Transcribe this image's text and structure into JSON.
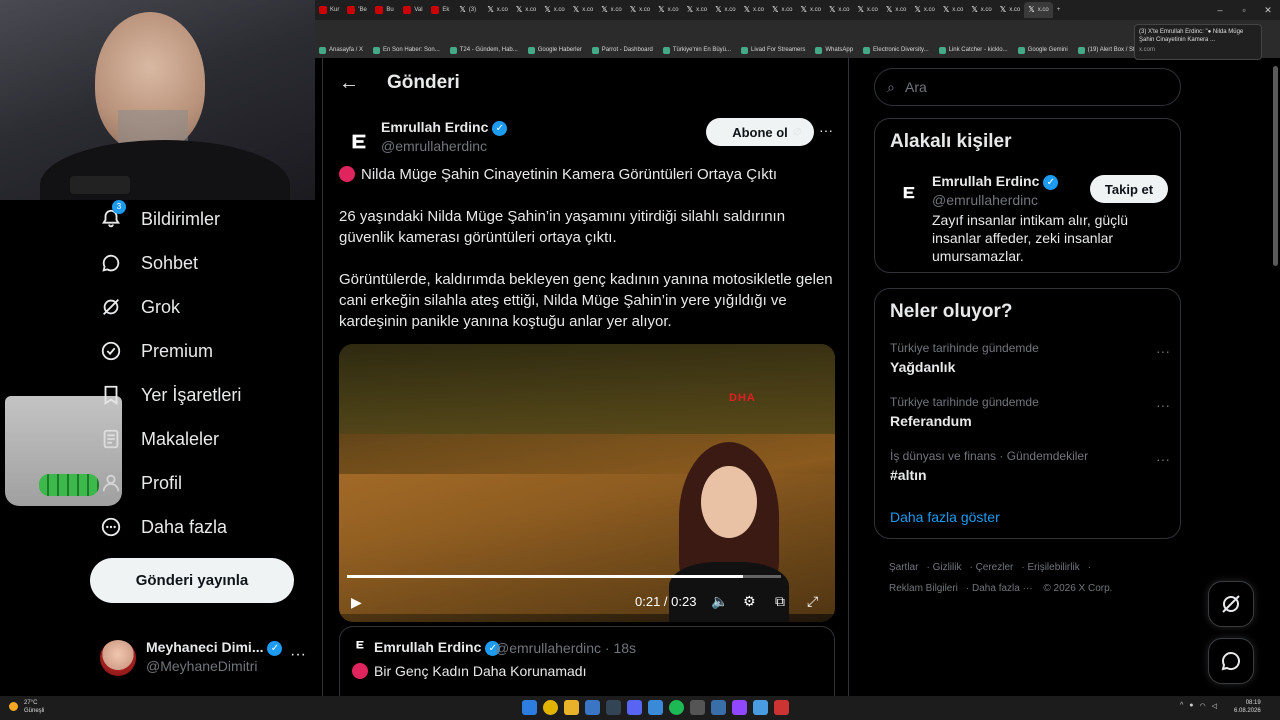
{
  "browser": {
    "tabs": [
      {
        "icon": "youtube-icon",
        "label": "Kur"
      },
      {
        "icon": "youtube-icon",
        "label": "'Be"
      },
      {
        "icon": "youtube-icon",
        "label": "Bu"
      },
      {
        "icon": "youtube-icon",
        "label": "Val"
      },
      {
        "icon": "youtube-icon",
        "label": "Ek"
      },
      {
        "icon": "x-icon",
        "label": "(3)"
      },
      {
        "icon": "x-icon",
        "label": "x.co"
      },
      {
        "icon": "x-icon",
        "label": "x.co"
      },
      {
        "icon": "x-icon",
        "label": "x.co"
      },
      {
        "icon": "x-icon",
        "label": "x.co"
      },
      {
        "icon": "x-icon",
        "label": "x.co"
      },
      {
        "icon": "x-icon",
        "label": "x.co"
      },
      {
        "icon": "x-icon",
        "label": "x.co"
      },
      {
        "icon": "x-icon",
        "label": "x.co"
      },
      {
        "icon": "x-icon",
        "label": "x.co"
      },
      {
        "icon": "x-icon",
        "label": "x.co"
      },
      {
        "icon": "x-icon",
        "label": "x.co"
      },
      {
        "icon": "x-icon",
        "label": "x.co"
      },
      {
        "icon": "x-icon",
        "label": "x.co"
      },
      {
        "icon": "x-icon",
        "label": "x.co"
      },
      {
        "icon": "x-icon",
        "label": "x.co"
      },
      {
        "icon": "x-icon",
        "label": "x.co"
      },
      {
        "icon": "x-icon",
        "label": "x.co"
      },
      {
        "icon": "x-icon",
        "label": "x.co"
      },
      {
        "icon": "x-icon",
        "label": "x.co"
      },
      {
        "icon": "x-icon",
        "label": "x.co"
      }
    ],
    "tab_tooltip": {
      "title": "(3) X'te Emrullah Erdinc: \"● Nilda Müge Şahin Cinayetinin Kamera ...",
      "url": "x.com"
    },
    "bookmarks": [
      "Anasayfa / X",
      "En Son Haber: Son...",
      "T24 - Gündem, Hab...",
      "Google Haberler",
      "Parrot - Dashboard",
      "Türkiye'nin En Büyü...",
      "Livad For Streamers",
      "WhatsApp",
      "Electronic Diversity...",
      "Link Catcher - kicklo...",
      "Google Gemini",
      "(19) Alert Box / Stre..."
    ]
  },
  "nav": {
    "notifications_badge": "3",
    "items": [
      {
        "label": "Bildirimler",
        "icon": "bell-icon"
      },
      {
        "label": "Sohbet",
        "icon": "chat-icon"
      },
      {
        "label": "Grok",
        "icon": "grok-icon"
      },
      {
        "label": "Premium",
        "icon": "verified-badge-icon"
      },
      {
        "label": "Yer İşaretleri",
        "icon": "bookmark-icon"
      },
      {
        "label": "Makaleler",
        "icon": "article-icon"
      },
      {
        "label": "Profil",
        "icon": "user-icon"
      },
      {
        "label": "Daha fazla",
        "icon": "more-circle-icon"
      }
    ],
    "post_button": "Gönderi yayınla",
    "account": {
      "name": "Meyhaneci Dimi...",
      "handle": "@MeyhaneDimitri"
    }
  },
  "main": {
    "title": "Gönderi",
    "author": {
      "name": "Emrullah Erdinc",
      "handle": "@emrullaherdinc",
      "logo": "E"
    },
    "subscribe_label": "Abone ol",
    "paragraphs": [
      "Nilda Müge Şahin Cinayetinin Kamera Görüntüleri Ortaya Çıktı",
      "26 yaşındaki Nilda Müge Şahin’in yaşamını yitirdiği silahlı saldırının güvenlik kamerası görüntüleri ortaya çıktı.",
      "Görüntülerde, kaldırımda bekleyen genç kadının yanına motosikletle gelen cani erkeğin silahla ateş ettiği, Nilda Müge Şahin’in yere yığıldığı ve kardeşinin panikle yanına koştuğu anlar yer alıyor."
    ],
    "video": {
      "watermark": "DHA",
      "time": "0:21 / 0:23",
      "progress": 0.913
    },
    "quote": {
      "name": "Emrullah Erdinc",
      "handle": "@emrullaherdinc · 18s",
      "text": "Bir Genç Kadın Daha Korunamadı"
    }
  },
  "right": {
    "search_placeholder": "Ara",
    "relevant": {
      "title": "Alakalı kişiler",
      "name": "Emrullah Erdinc",
      "handle": "@emrullaherdinc",
      "follow_label": "Takip et",
      "bio": "Zayıf insanlar intikam alır, güçlü insanlar affeder, zeki insanlar umursamazlar."
    },
    "trends": {
      "title": "Neler oluyor?",
      "items": [
        {
          "context": "Türkiye tarihinde gündemde",
          "name": "Yağdanlık"
        },
        {
          "context": "Türkiye tarihinde gündemde",
          "name": "Referandum"
        },
        {
          "context": "İş dünyası ve finans · Gündemdekiler",
          "name": "#altın"
        }
      ],
      "show_more": "Daha fazla göster"
    },
    "footer": {
      "links": [
        "Şartlar",
        "Gizlilik",
        "Çerezler",
        "Erişilebilirlik",
        "Reklam Bilgileri",
        "Daha fazla ···"
      ],
      "copyright": "© 2026 X Corp."
    }
  },
  "taskbar": {
    "weather_temp": "27°C",
    "weather_desc": "Güneşli",
    "time": "08:19",
    "date": "6.08.2026"
  },
  "colors": {
    "accent": "#1d9bf0",
    "background": "#000000",
    "muted": "#71767b",
    "red_dot": "#e0245e"
  }
}
